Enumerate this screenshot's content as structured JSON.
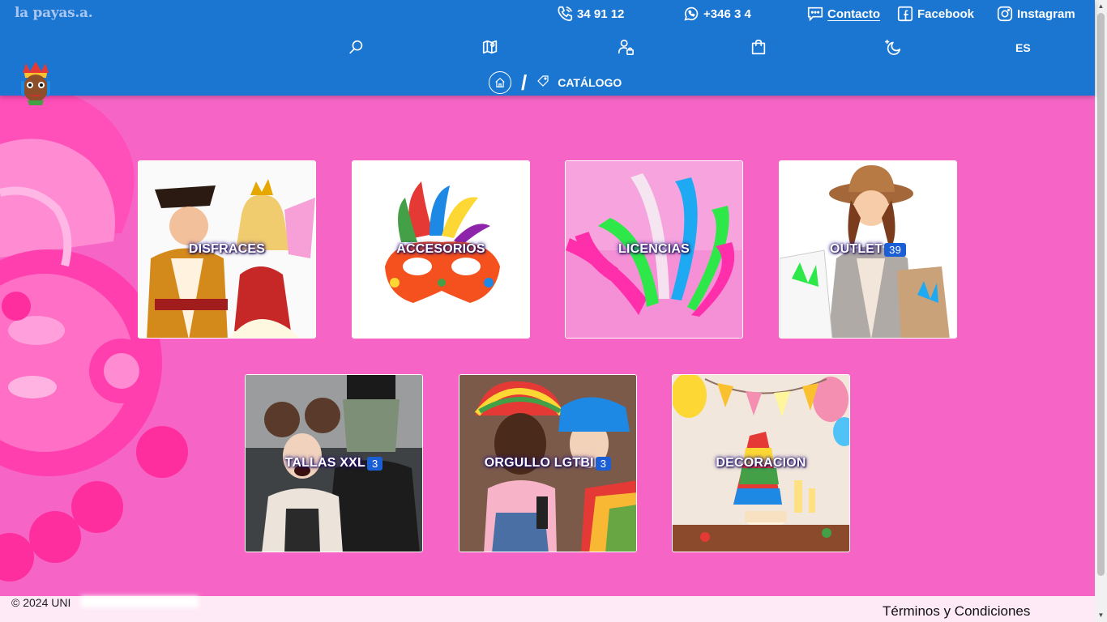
{
  "header": {
    "brand": "la payas.a.",
    "phone": "34 91   12",
    "whatsapp": "+346   3  4",
    "contact": "Contacto",
    "facebook": "Facebook",
    "instagram": "Instagram",
    "language": "ES",
    "nav_icons": [
      "search-icon",
      "map-icon",
      "user-lock-icon",
      "shopping-bag-icon",
      "moon-stars-icon"
    ]
  },
  "breadcrumb": {
    "separator": "/",
    "current": "CATÁLOGO"
  },
  "categories": [
    {
      "label": "DISFRACES",
      "badge": null
    },
    {
      "label": "ACCESORIOS",
      "badge": null
    },
    {
      "label": "LICENCIAS",
      "badge": null
    },
    {
      "label": "OUTLET",
      "badge": "39"
    },
    {
      "label": "TALLAS XXL",
      "badge": "3"
    },
    {
      "label": "ORGULLO LGTBI",
      "badge": "3"
    },
    {
      "label": "DECORACION",
      "badge": null
    }
  ],
  "footer": {
    "copyright": "© 2024 UNI",
    "terms": "Términos y Condiciones"
  },
  "colors": {
    "header_bg": "#1b76d2",
    "page_bg": "#f665c6",
    "badge_bg": "#1b5fd6",
    "footer_bg": "#fdeaf6"
  }
}
